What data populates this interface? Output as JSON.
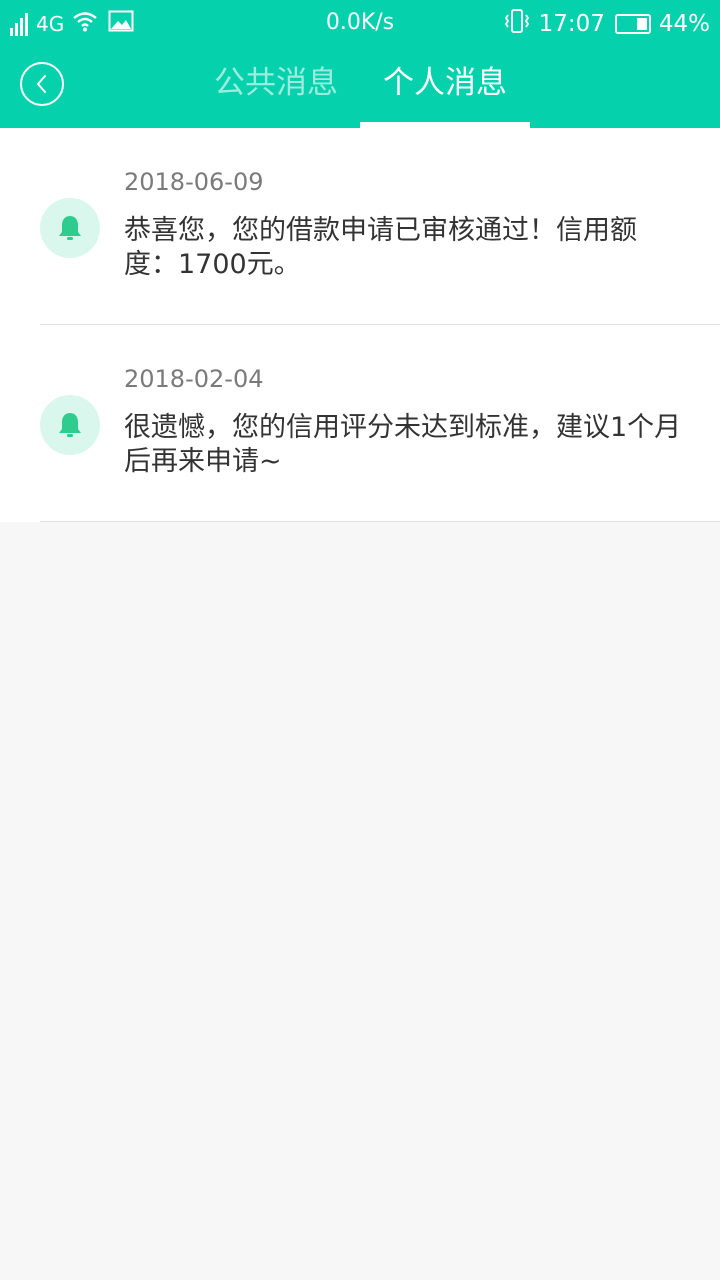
{
  "status_bar": {
    "network": "4G",
    "speed": "0.0K/s",
    "time": "17:07",
    "battery": "44%",
    "icons": [
      "signal-icon",
      "wifi-icon",
      "image-icon",
      "vibrate-icon",
      "battery-icon"
    ]
  },
  "nav": {
    "back_icon": "chevron-left-icon",
    "tabs": [
      {
        "label": "公共消息",
        "active": false
      },
      {
        "label": "个人消息",
        "active": true
      }
    ]
  },
  "messages": [
    {
      "date": "2018-06-09",
      "text": "恭喜您，您的借款申请已审核通过！信用额度：1700元。",
      "icon": "bell-icon"
    },
    {
      "date": "2018-02-04",
      "text": "很遗憾，您的信用评分未达到标准，建议1个月后再来申请~",
      "icon": "bell-icon"
    }
  ],
  "colors": {
    "accent": "#06d1ad",
    "bell": "#2ecc8e",
    "bell_bg": "#d9f7ec",
    "background": "#f7f7f7"
  }
}
